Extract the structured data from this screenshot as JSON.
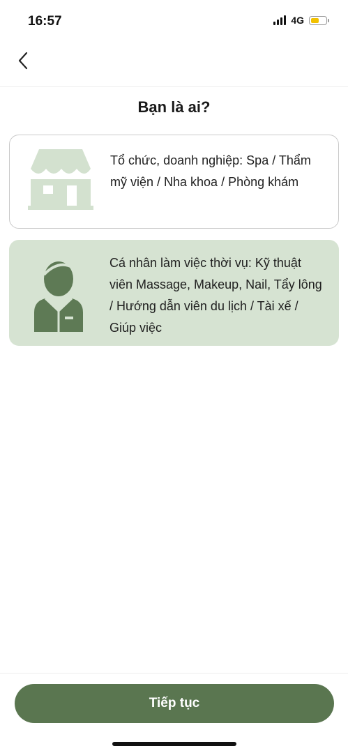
{
  "status_bar": {
    "time": "16:57",
    "network": "4G",
    "battery_color": "#f2c100"
  },
  "nav": {
    "back_icon": "chevron-left-icon"
  },
  "title": "Bạn là ai?",
  "options": [
    {
      "icon": "storefront-icon",
      "label": "Tổ chức, doanh nghiệp: Spa / Thẩm mỹ viện / Nha khoa / Phòng khám",
      "selected": false
    },
    {
      "icon": "person-worker-icon",
      "label": "Cá nhân làm việc thời vụ: Kỹ thuật viên Massage, Makeup, Nail, Tẩy lông / Hướng dẫn viên du lịch / Tài xế / Giúp việc",
      "selected": true
    }
  ],
  "continue_button": {
    "label": "Tiếp tục"
  },
  "colors": {
    "accent": "#5a7650",
    "selected_bg": "#d6e3d2",
    "icon_light": "#d3e1cf",
    "icon_dark": "#5e7a55"
  }
}
